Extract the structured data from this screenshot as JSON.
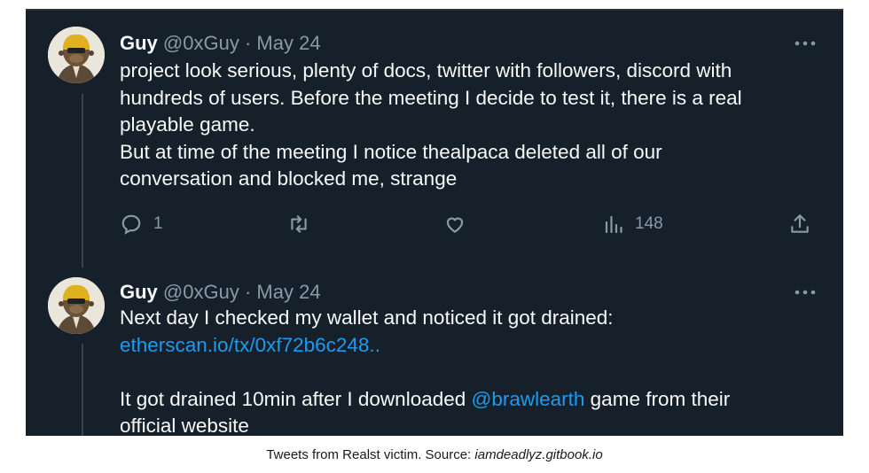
{
  "tweets": [
    {
      "name": "Guy",
      "handle": "@0xGuy",
      "separator": "·",
      "date": "May 24",
      "lines": [
        "project look serious, plenty of docs, twitter with followers, discord with",
        "hundreds of users. Before the meeting I decide to test it, there is a real",
        "playable game.",
        "But at time of the meeting I notice thealpaca deleted all of our",
        "conversation and blocked me, strange"
      ],
      "actions": {
        "reply_count": "1",
        "retweet_count": "",
        "like_count": "",
        "views_count": "148"
      }
    },
    {
      "name": "Guy",
      "handle": "@0xGuy",
      "separator": "·",
      "date": "May 24",
      "line1": "Next day I checked my wallet and noticed it got drained:",
      "link": "etherscan.io/tx/0xf72b6c248..",
      "line3_pre": "It got drained 10min after I downloaded ",
      "mention": "@brawlearth",
      "line3_post": " game from their",
      "line4": "official website"
    }
  ],
  "caption": {
    "text": "Tweets from Realst victim. Source: ",
    "source": "iamdeadlyz.gitbook.io"
  },
  "colors": {
    "background": "#15202b",
    "text": "#f7f9f9",
    "muted": "#8b98a5",
    "link": "#1d9bf0"
  }
}
